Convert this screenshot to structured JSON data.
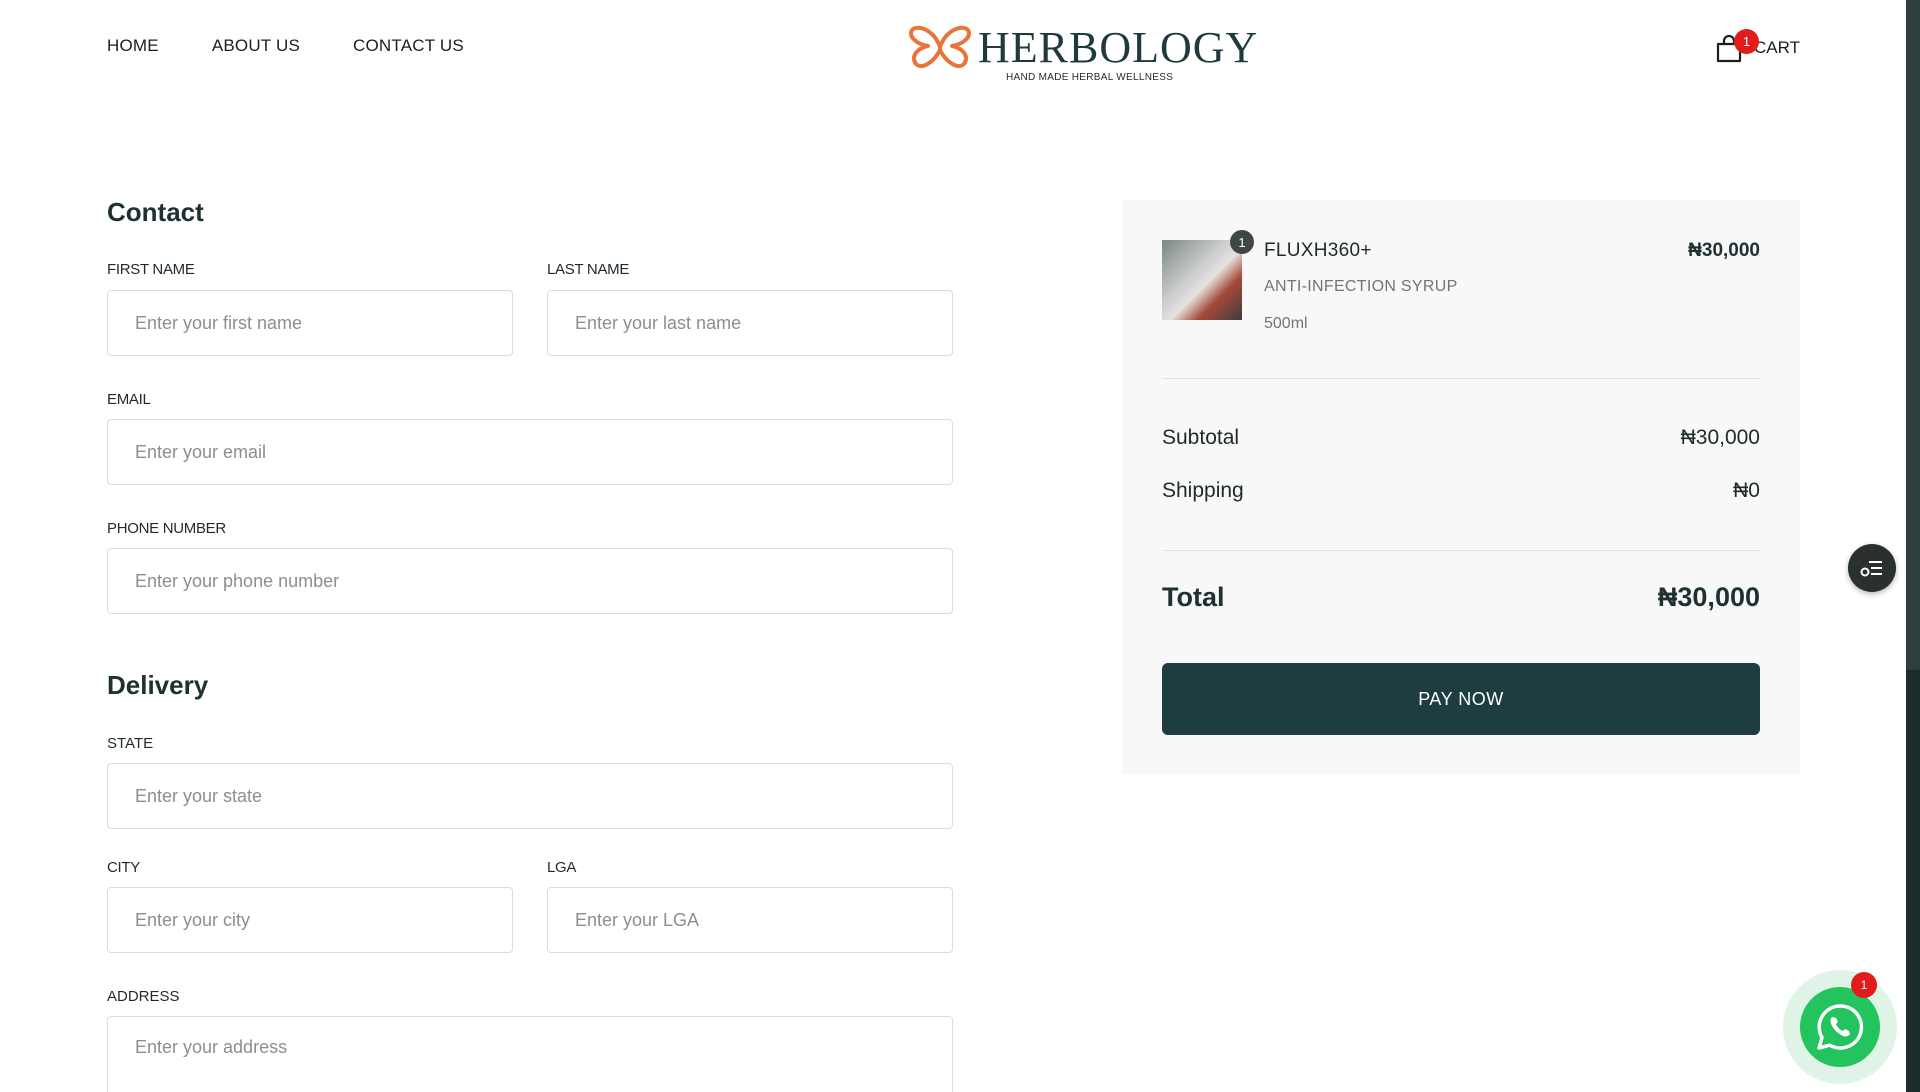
{
  "nav": {
    "home": "HOME",
    "about": "ABOUT US",
    "contact": "CONTACT US"
  },
  "logo": {
    "name": "HERBOLOGY",
    "tagline": "HAND MADE HERBAL WELLNESS"
  },
  "cart": {
    "label": "CART",
    "count": "1"
  },
  "contact": {
    "title": "Contact",
    "first_name_label": "FIRST NAME",
    "first_name_placeholder": "Enter your first name",
    "last_name_label": "LAST NAME",
    "last_name_placeholder": "Enter your last name",
    "email_label": "EMAIL",
    "email_placeholder": "Enter your email",
    "phone_label": "PHONE NUMBER",
    "phone_placeholder": "Enter your phone number"
  },
  "delivery": {
    "title": "Delivery",
    "state_label": "STATE",
    "state_placeholder": "Enter your state",
    "city_label": "CITY",
    "city_placeholder": "Enter your city",
    "lga_label": "LGA",
    "lga_placeholder": "Enter your LGA",
    "address_label": "ADDRESS",
    "address_placeholder": "Enter your address"
  },
  "summary": {
    "product": {
      "name": "FLUXH360+",
      "subtitle": "ANTI-INFECTION SYRUP",
      "size": "500ml",
      "price": "₦30,000",
      "qty": "1"
    },
    "subtotal_label": "Subtotal",
    "subtotal_value": "₦30,000",
    "shipping_label": "Shipping",
    "shipping_value": "₦0",
    "total_label": "Total",
    "total_value": "₦30,000",
    "pay_label": "PAY NOW"
  },
  "whatsapp": {
    "badge": "1"
  },
  "colors": {
    "brand": "#1e3d40",
    "accent": "#e8743b",
    "badge": "#e21b1b",
    "whatsapp": "#23c45e"
  }
}
